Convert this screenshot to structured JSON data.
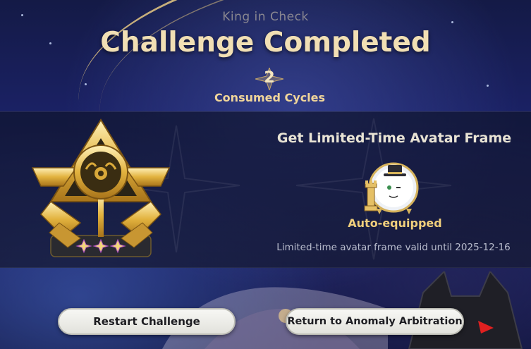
{
  "header": {
    "subtitle": "King in Check",
    "title": "Challenge Completed",
    "cycles_value": "2",
    "cycles_label": "Consumed Cycles"
  },
  "emblem": {
    "stars": 3
  },
  "reward": {
    "heading": "Get Limited-Time Avatar Frame",
    "status": "Auto-equipped",
    "note": "Limited-time avatar frame valid until 2025-12-16"
  },
  "buttons": {
    "restart_label": "Restart Challenge",
    "return_label": "Return to Anomaly Arbitration"
  },
  "colors": {
    "title": "#f1dfb4",
    "gold": "#f0cf7c",
    "button_bg": "#f0f0ec"
  }
}
